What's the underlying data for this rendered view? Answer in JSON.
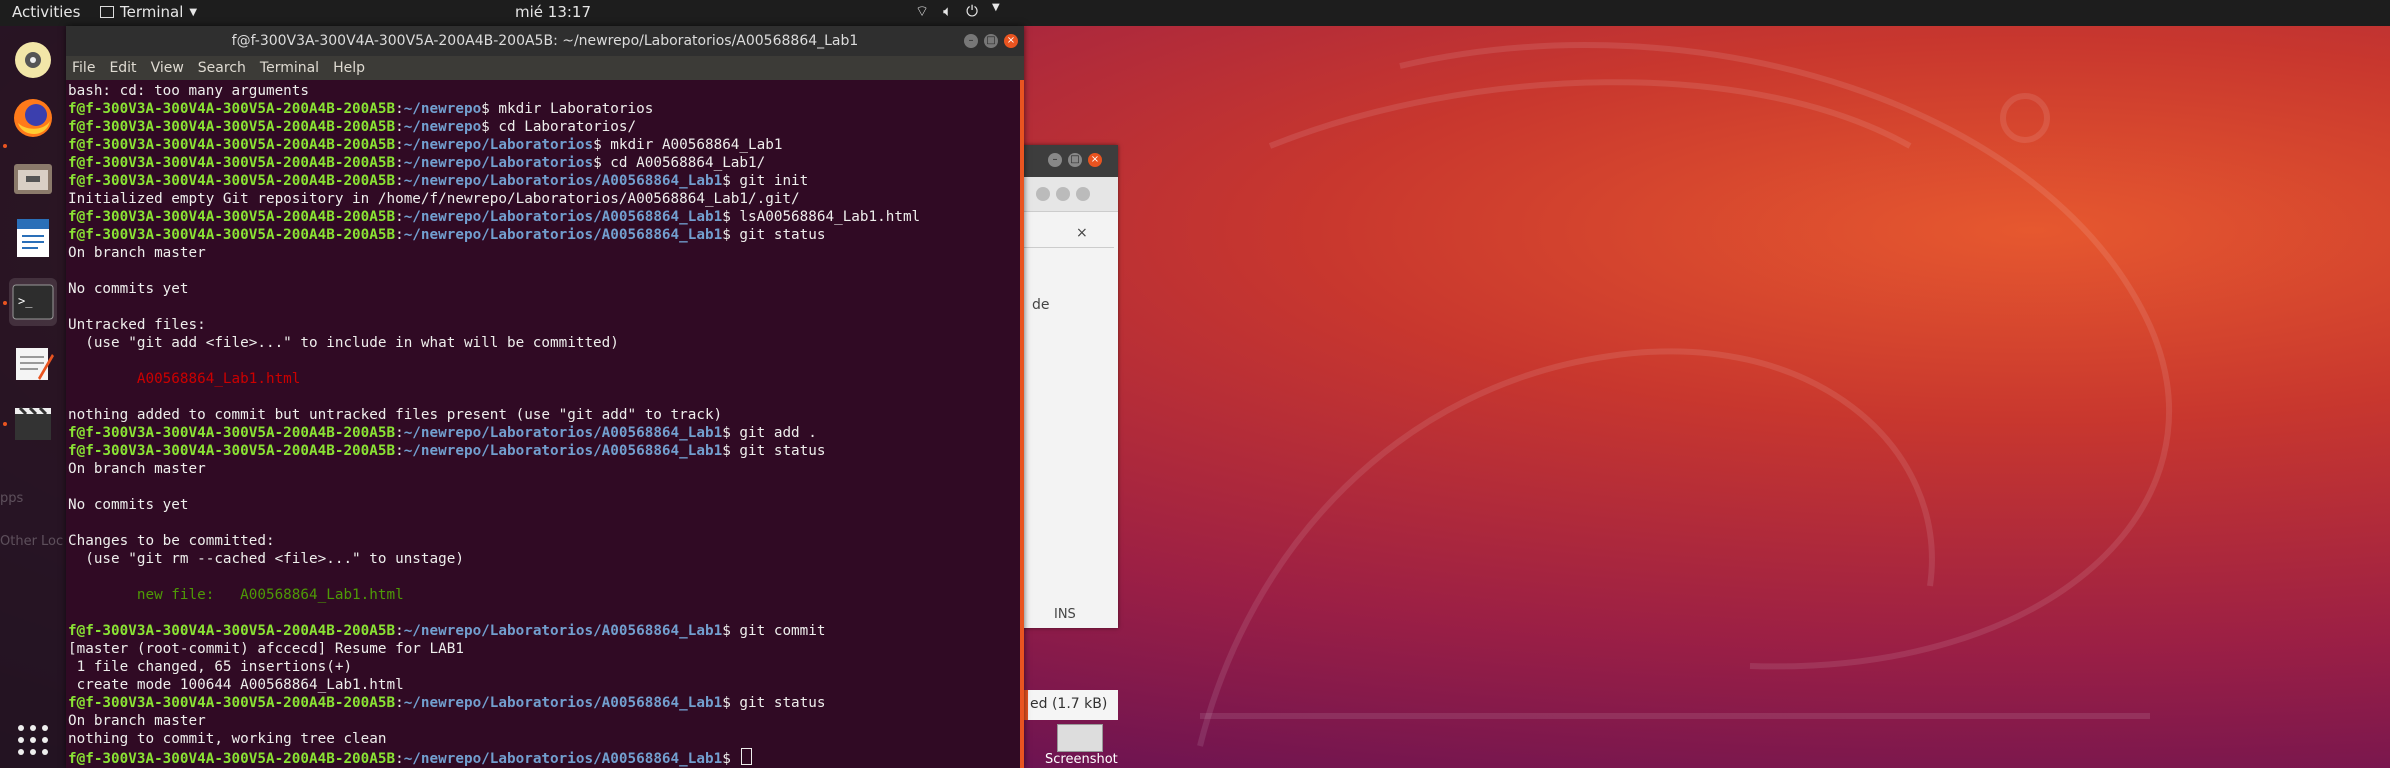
{
  "topbar": {
    "activities": "Activities",
    "app_name": "Terminal",
    "clock": "mié 13:17"
  },
  "dock": {
    "items": [
      "rhythmbox-icon",
      "firefox-icon",
      "files-icon",
      "libreoffice-writer-icon",
      "terminal-icon",
      "text-editor-icon",
      "video-icon",
      "show-apps-icon"
    ]
  },
  "terminal": {
    "title": "f@f-300V3A-300V4A-300V5A-200A4B-200A5B: ~/newrepo/Laboratorios/A00568864_Lab1",
    "menu": [
      "File",
      "Edit",
      "View",
      "Search",
      "Terminal",
      "Help"
    ],
    "prompt_user": "f@f-300V3A-300V4A-300V5A-200A4B-200A5B",
    "lines": [
      {
        "t": "out",
        "text": "bash: cd: too many arguments"
      },
      {
        "t": "cmd",
        "path": "~/newrepo",
        "cmd": "mkdir Laboratorios"
      },
      {
        "t": "cmd",
        "path": "~/newrepo",
        "cmd": "cd Laboratorios/"
      },
      {
        "t": "cmd",
        "path": "~/newrepo/Laboratorios",
        "cmd": "mkdir A00568864_Lab1"
      },
      {
        "t": "cmd",
        "path": "~/newrepo/Laboratorios",
        "cmd": "cd A00568864_Lab1/"
      },
      {
        "t": "cmd",
        "path": "~/newrepo/Laboratorios/A00568864_Lab1",
        "cmd": "git init"
      },
      {
        "t": "out",
        "text": "Initialized empty Git repository in /home/f/newrepo/Laboratorios/A00568864_Lab1/.git/"
      },
      {
        "t": "cmd",
        "path": "~/newrepo/Laboratorios/A00568864_Lab1",
        "cmd": "lsA00568864_Lab1.html"
      },
      {
        "t": "cmd",
        "path": "~/newrepo/Laboratorios/A00568864_Lab1",
        "cmd": "git status"
      },
      {
        "t": "out",
        "text": "On branch master"
      },
      {
        "t": "out",
        "text": ""
      },
      {
        "t": "out",
        "text": "No commits yet"
      },
      {
        "t": "out",
        "text": ""
      },
      {
        "t": "out",
        "text": "Untracked files:"
      },
      {
        "t": "out",
        "text": "  (use \"git add <file>...\" to include in what will be committed)"
      },
      {
        "t": "out",
        "text": ""
      },
      {
        "t": "red",
        "text": "\tA00568864_Lab1.html"
      },
      {
        "t": "out",
        "text": ""
      },
      {
        "t": "out",
        "text": "nothing added to commit but untracked files present (use \"git add\" to track)"
      },
      {
        "t": "cmd",
        "path": "~/newrepo/Laboratorios/A00568864_Lab1",
        "cmd": "git add ."
      },
      {
        "t": "cmd",
        "path": "~/newrepo/Laboratorios/A00568864_Lab1",
        "cmd": "git status"
      },
      {
        "t": "out",
        "text": "On branch master"
      },
      {
        "t": "out",
        "text": ""
      },
      {
        "t": "out",
        "text": "No commits yet"
      },
      {
        "t": "out",
        "text": ""
      },
      {
        "t": "out",
        "text": "Changes to be committed:"
      },
      {
        "t": "out",
        "text": "  (use \"git rm --cached <file>...\" to unstage)"
      },
      {
        "t": "out",
        "text": ""
      },
      {
        "t": "green",
        "text": "\tnew file:   A00568864_Lab1.html"
      },
      {
        "t": "out",
        "text": ""
      },
      {
        "t": "cmd",
        "path": "~/newrepo/Laboratorios/A00568864_Lab1",
        "cmd": "git commit"
      },
      {
        "t": "out",
        "text": "[master (root-commit) afccecd] Resume for LAB1"
      },
      {
        "t": "out",
        "text": " 1 file changed, 65 insertions(+)"
      },
      {
        "t": "out",
        "text": " create mode 100644 A00568864_Lab1.html"
      },
      {
        "t": "cmd",
        "path": "~/newrepo/Laboratorios/A00568864_Lab1",
        "cmd": "git status"
      },
      {
        "t": "out",
        "text": "On branch master"
      },
      {
        "t": "out",
        "text": "nothing to commit, working tree clean"
      },
      {
        "t": "cursor",
        "path": "~/newrepo/Laboratorios/A00568864_Lab1"
      }
    ]
  },
  "background_window": {
    "tab_close": "×",
    "text_de": "de",
    "ins": "INS",
    "file_size": "ed (1.7 kB)",
    "screenshot_label": "Screenshot"
  },
  "colors": {
    "terminal_bg": "#300a24",
    "prompt_user": "#8ae234",
    "prompt_path": "#729fcf",
    "accent": "#e95420"
  }
}
